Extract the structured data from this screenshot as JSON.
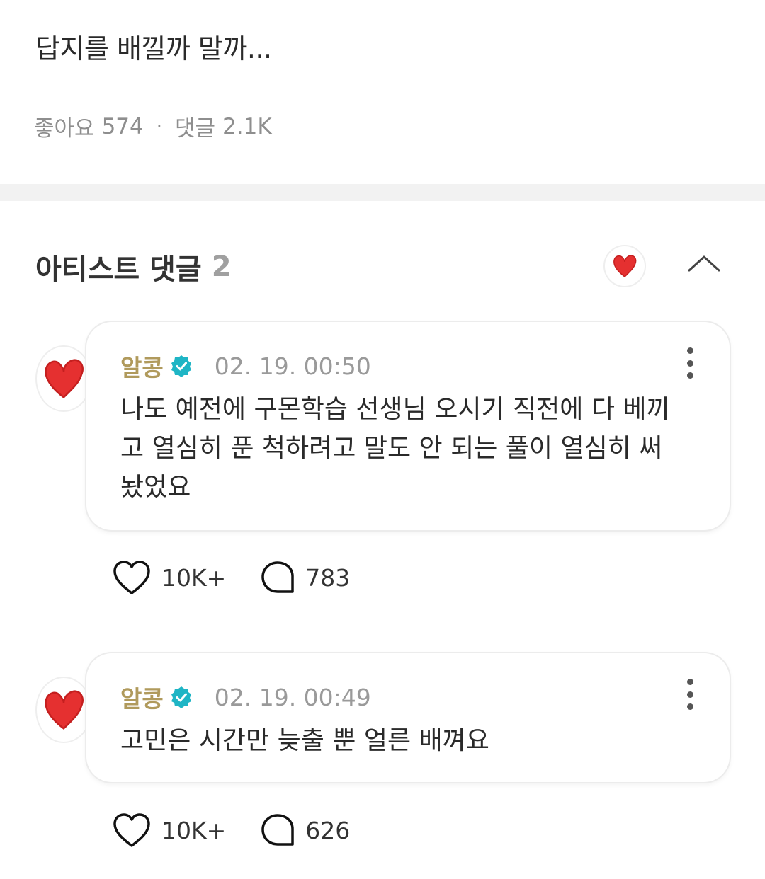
{
  "post": {
    "text": "답지를 배낄까 말까...",
    "likes_label": "좋아요",
    "likes_count": "574",
    "separator": "·",
    "comments_label": "댓글",
    "comments_count": "2.1K"
  },
  "section": {
    "title": "아티스트 댓글",
    "count": "2"
  },
  "icons": {
    "heart_avatar": "red-heart-drawing",
    "collapse": "chevron-up-icon",
    "verified": "verified-badge-icon",
    "more": "more-vertical-icon",
    "like": "heart-outline-icon",
    "reply": "speech-bubble-icon"
  },
  "colors": {
    "author": "#b09a5c",
    "verified": "#1fb5c5",
    "heart": "#e53030"
  },
  "comments": [
    {
      "author": "알콩",
      "timestamp": "02. 19. 00:50",
      "text": "나도 예전에 구몬학습 선생님 오시기 직전에 다 베끼고 열심히 푼 척하려고 말도 안 되는 풀이 열심히 써놨었요",
      "likes": "10K+",
      "replies": "783"
    },
    {
      "author": "알콩",
      "timestamp": "02. 19. 00:49",
      "text": "고민은 시간만 늦출 뿐 얼른 배껴요",
      "likes": "10K+",
      "replies": "626"
    }
  ]
}
